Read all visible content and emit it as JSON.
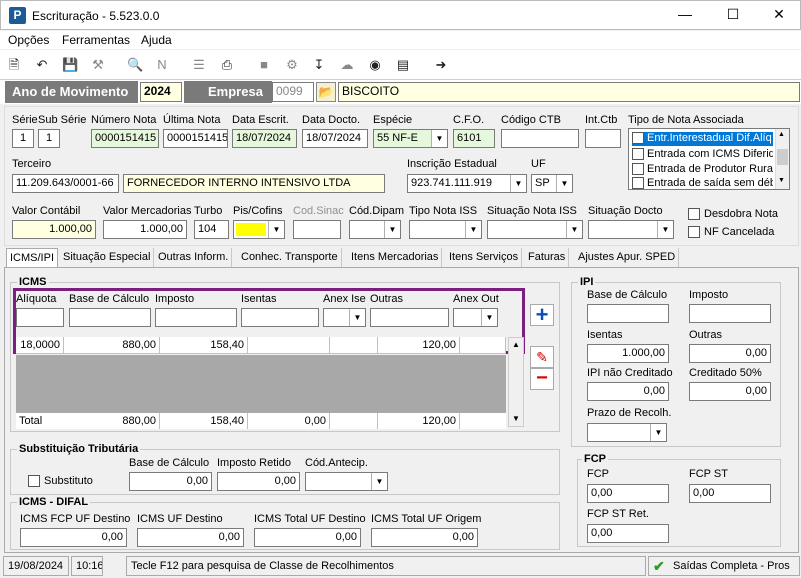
{
  "window": {
    "title": "Escrituração - 5.523.0.0",
    "app_icon": "P"
  },
  "menu": [
    "Opções",
    "Ferramentas",
    "Ajuda"
  ],
  "header": {
    "ano_label": "Ano de Movimento",
    "ano": "2024",
    "empresa_label": "Empresa",
    "empresa_code": "0099",
    "empresa_name": "BISCOITO"
  },
  "labels": {
    "serie": "Série",
    "sub_serie": "Sub Série",
    "numero_nota": "Número Nota",
    "ultima_nota": "Última Nota",
    "data_escrit": "Data Escrit.",
    "data_docto": "Data Docto.",
    "especie": "Espécie",
    "cfo": "C.F.O.",
    "codigo_ctb": "Código CTB",
    "int_ctb": "Int.Ctb",
    "tipo_nota_assoc": "Tipo de Nota Associada",
    "terceiro": "Terceiro",
    "insc_estadual": "Inscrição Estadual",
    "uf": "UF",
    "valor_contabil": "Valor Contábil",
    "valor_mercadorias": "Valor Mercadorias",
    "turbo": "Turbo",
    "pis_cofins": "Pis/Cofins",
    "cod_sinac": "Cod.Sinac",
    "cod_dipam": "Cód.Dipam",
    "tipo_nota_iss": "Tipo Nota ISS",
    "situacao_nota_iss": "Situação Nota ISS",
    "situacao_docto": "Situação Docto",
    "desdobra_nota": "Desdobra Nota",
    "nf_cancelada": "NF Cancelada"
  },
  "values": {
    "serie": "1",
    "sub_serie": "1",
    "numero_nota": "0000151415",
    "ultima_nota": "0000151415",
    "data_escrit": "18/07/2024",
    "data_docto": "18/07/2024",
    "especie": "55 NF-E",
    "cfo": "6101",
    "terceiro_doc": "11.209.643/0001-66",
    "terceiro_nome": "FORNECEDOR INTERNO INTENSIVO LTDA",
    "insc_estadual": "923.741.111.919",
    "uf": "SP",
    "valor_contabil": "1.000,00",
    "valor_mercadorias": "1.000,00",
    "turbo": "104"
  },
  "tipo_nota_list": [
    "Entr.Interestadual Dif.Alíq",
    "Entrada com ICMS Diferido",
    "Entrada de Produtor Rural",
    "Entrada de saída sem débi"
  ],
  "tabs": [
    "ICMS/IPI",
    "Situação Especial",
    "Outras Inform.",
    "Conhec. Transporte",
    "Itens Mercadorias",
    "Itens Serviços",
    "Faturas",
    "Ajustes Apur. SPED"
  ],
  "icms": {
    "title": "ICMS",
    "columns": [
      "Alíquota",
      "Base de Cálculo",
      "Imposto",
      "Isentas",
      "Anex Ise",
      "Outras",
      "Anex Out"
    ],
    "row": [
      "18,0000",
      "880,00",
      "158,40",
      "",
      "",
      "120,00",
      ""
    ],
    "total_label": "Total",
    "totals": [
      "880,00",
      "158,40",
      "0,00",
      "",
      "120,00"
    ]
  },
  "st": {
    "title": "Substituição Tributária",
    "substituto": "Substituto",
    "base_label": "Base de Cálculo",
    "base": "0,00",
    "imposto_label": "Imposto Retido",
    "imposto": "0,00",
    "cod_label": "Cód.Antecip."
  },
  "difal": {
    "title": "ICMS - DIFAL",
    "labels": [
      "ICMS FCP UF Destino",
      "ICMS UF Destino",
      "ICMS Total UF Destino",
      "ICMS Total UF Origem"
    ],
    "values": [
      "0,00",
      "0,00",
      "0,00",
      "0,00"
    ]
  },
  "ipi": {
    "title": "IPI",
    "base_label": "Base de Cálculo",
    "imposto_label": "Imposto",
    "isentas_label": "Isentas",
    "isentas": "1.000,00",
    "outras_label": "Outras",
    "outras": "0,00",
    "nao_cred_label": "IPI não Creditado",
    "nao_cred": "0,00",
    "cred50_label": "Creditado 50%",
    "cred50": "0,00",
    "prazo_label": "Prazo de Recolh."
  },
  "fcp": {
    "title": "FCP",
    "fcp_label": "FCP",
    "fcp": "0,00",
    "fcp_st_label": "FCP ST",
    "fcp_st": "0,00",
    "fcp_st_ret_label": "FCP ST Ret.",
    "fcp_st_ret": "0,00"
  },
  "status": {
    "date": "19/08/2024",
    "time": "10:16",
    "hint": "Tecle F12 para pesquisa de Classe de Recolhimentos",
    "mode": "Saídas Completa - Pros"
  },
  "colors": {
    "highlight_border": "#7b1f7f",
    "accent_blue": "#0a4fb8",
    "selection": "#0078d7"
  }
}
